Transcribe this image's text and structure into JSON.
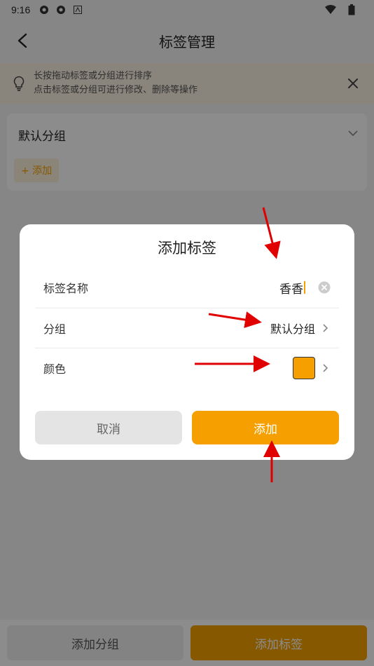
{
  "status_bar": {
    "time": "9:16"
  },
  "header": {
    "title": "标签管理"
  },
  "tip": {
    "line1": "长按拖动标签或分组进行排序",
    "line2": "点击标签或分组可进行修改、删除等操作"
  },
  "group": {
    "name": "默认分组",
    "add_label": "+ 添加"
  },
  "bottom": {
    "add_group": "添加分组",
    "add_label": "添加标签"
  },
  "dialog": {
    "title": "添加标签",
    "name_label": "标签名称",
    "name_value": "香香",
    "group_label": "分组",
    "group_value": "默认分组",
    "color_label": "颜色",
    "color_value": "#f5a000",
    "cancel": "取消",
    "confirm": "添加"
  },
  "colors": {
    "accent": "#f5a000",
    "arrow": "#e00000"
  }
}
